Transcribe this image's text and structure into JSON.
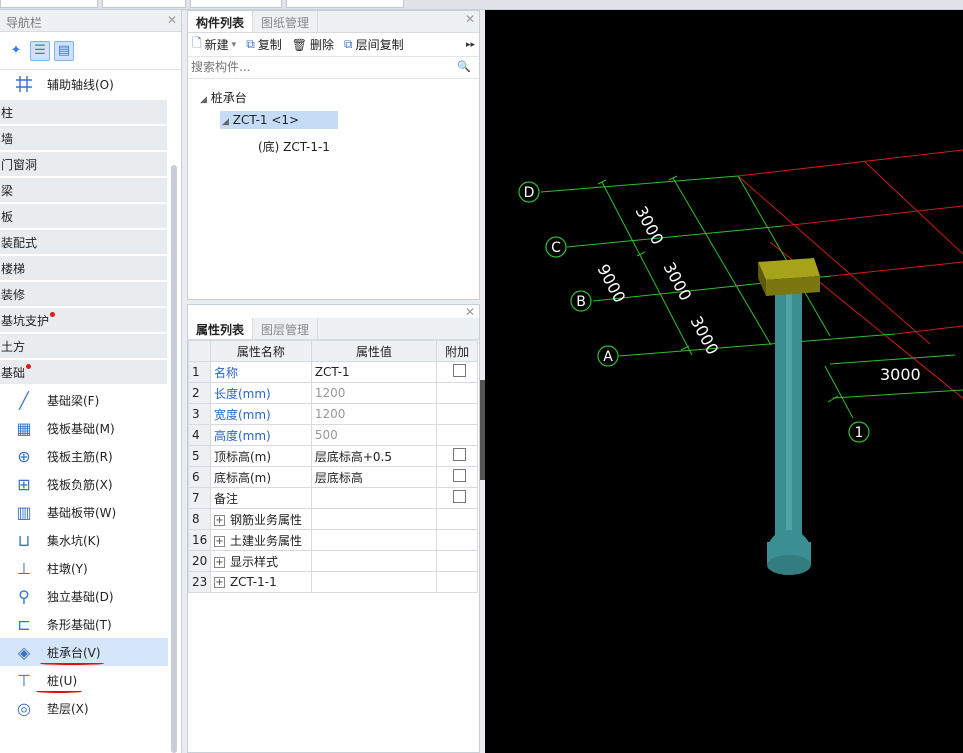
{
  "nav": {
    "title": "导航栏",
    "axis_item": "辅助轴线(O)",
    "categories": [
      "柱",
      "墙",
      "门窗洞",
      "梁",
      "板",
      "装配式",
      "楼梯",
      "装修",
      "基坑支护",
      "土方",
      "基础"
    ],
    "foundation_items": [
      "基础梁(F)",
      "筏板基础(M)",
      "筏板主筋(R)",
      "筏板负筋(X)",
      "基础板带(W)",
      "集水坑(K)",
      "柱墩(Y)",
      "独立基础(D)",
      "条形基础(T)",
      "桩承台(V)",
      "桩(U)",
      "垫层(X)"
    ]
  },
  "components": {
    "tabs": [
      "构件列表",
      "图纸管理"
    ],
    "toolbar": {
      "new": "新建",
      "copy": "复制",
      "delete": "删除",
      "floor_copy": "层间复制"
    },
    "search_placeholder": "搜索构件...",
    "tree": {
      "root": "桩承台",
      "child": "ZCT-1 <1>",
      "grandchild": "(底) ZCT-1-1"
    }
  },
  "properties": {
    "tabs": [
      "属性列表",
      "图层管理"
    ],
    "headers": [
      "属性名称",
      "属性值",
      "附加"
    ],
    "rows": [
      {
        "num": "1",
        "name": "名称",
        "value": "ZCT-1",
        "blue": true,
        "gray": false,
        "check": true,
        "expand": false
      },
      {
        "num": "2",
        "name": "长度(mm)",
        "value": "1200",
        "blue": true,
        "gray": true,
        "check": false,
        "expand": false
      },
      {
        "num": "3",
        "name": "宽度(mm)",
        "value": "1200",
        "blue": true,
        "gray": true,
        "check": false,
        "expand": false
      },
      {
        "num": "4",
        "name": "高度(mm)",
        "value": "500",
        "blue": true,
        "gray": true,
        "check": false,
        "expand": false
      },
      {
        "num": "5",
        "name": "顶标高(m)",
        "value": "层底标高+0.5",
        "blue": false,
        "gray": false,
        "check": true,
        "expand": false
      },
      {
        "num": "6",
        "name": "底标高(m)",
        "value": "层底标高",
        "blue": false,
        "gray": false,
        "check": true,
        "expand": false
      },
      {
        "num": "7",
        "name": "备注",
        "value": "",
        "blue": false,
        "gray": false,
        "check": true,
        "expand": false
      },
      {
        "num": "8",
        "name": "钢筋业务属性",
        "value": "",
        "blue": false,
        "gray": false,
        "check": false,
        "expand": true
      },
      {
        "num": "16",
        "name": "土建业务属性",
        "value": "",
        "blue": false,
        "gray": false,
        "check": false,
        "expand": true
      },
      {
        "num": "20",
        "name": "显示样式",
        "value": "",
        "blue": false,
        "gray": false,
        "check": false,
        "expand": true
      },
      {
        "num": "23",
        "name": "ZCT-1-1",
        "value": "",
        "blue": false,
        "gray": false,
        "check": false,
        "expand": true
      }
    ]
  },
  "viewport": {
    "axis_labels": [
      "D",
      "C",
      "B",
      "A",
      "1"
    ],
    "dims": [
      "3000",
      "3000",
      "3000",
      "9000",
      "3000"
    ],
    "colors": {
      "grid_green": "#2fbf2f",
      "grid_red": "#d11a1a",
      "pile": "#3b8f92",
      "cap": "#8c8a12"
    }
  }
}
